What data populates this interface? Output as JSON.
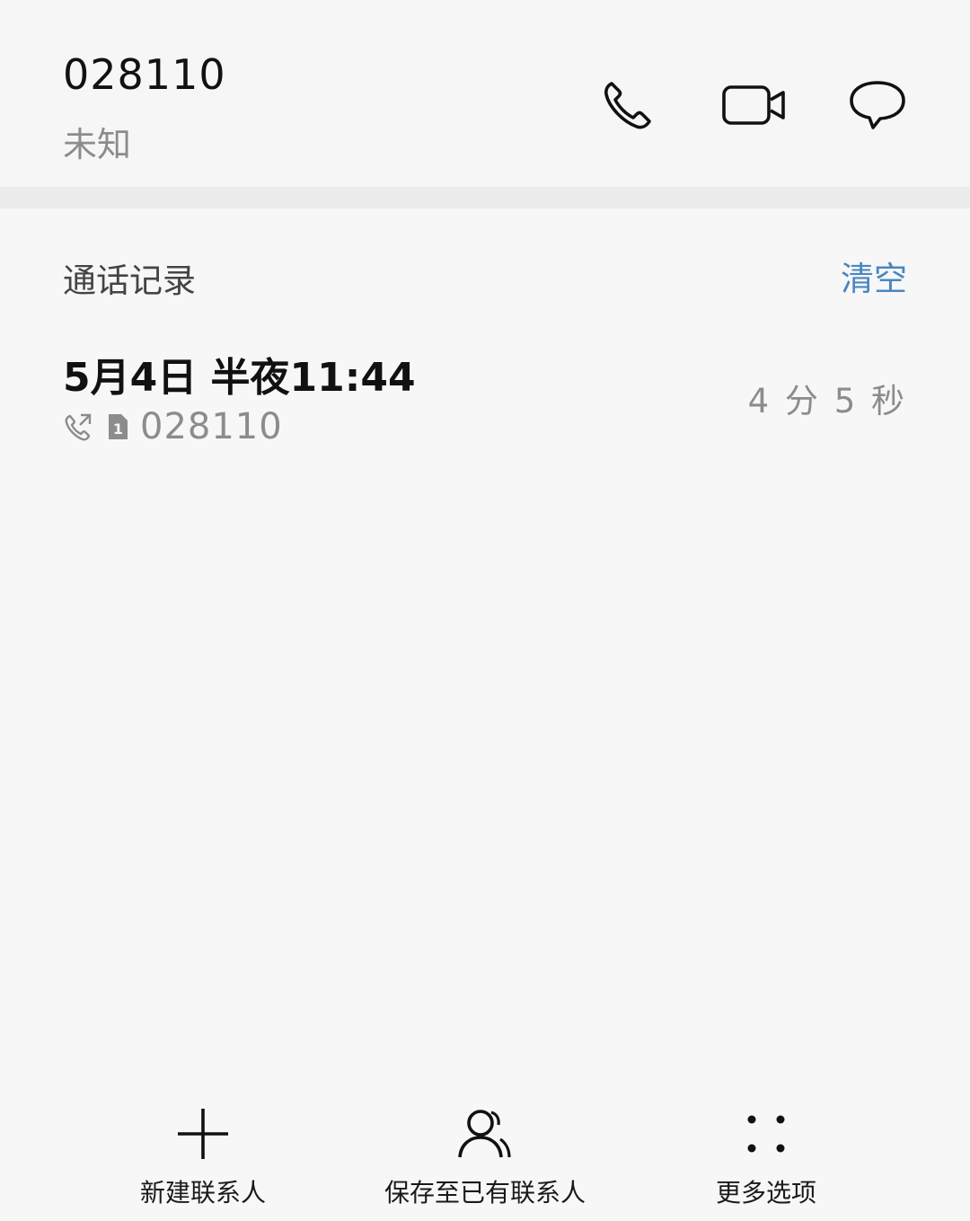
{
  "header": {
    "number": "028110",
    "location": "未知",
    "actions": [
      {
        "icon": "phone-icon"
      },
      {
        "icon": "video-call-icon"
      },
      {
        "icon": "message-icon"
      }
    ]
  },
  "call_log": {
    "title": "通话记录",
    "clear_label": "清空",
    "records": [
      {
        "time": "5月4日 半夜11:44",
        "number": "028110",
        "duration": "4 分 5 秒",
        "call_type_icon": "outgoing-call-icon",
        "sim_icon": "sim-1-icon"
      }
    ]
  },
  "bottom_bar": {
    "items": [
      {
        "label": "新建联系人",
        "icon": "plus-icon"
      },
      {
        "label": "保存至已有联系人",
        "icon": "contacts-icon"
      },
      {
        "label": "更多选项",
        "icon": "more-dots-icon"
      }
    ]
  },
  "colors": {
    "background": "#f7f7f7",
    "accent": "#4a86c0",
    "secondary_text": "#8c8c8c"
  }
}
